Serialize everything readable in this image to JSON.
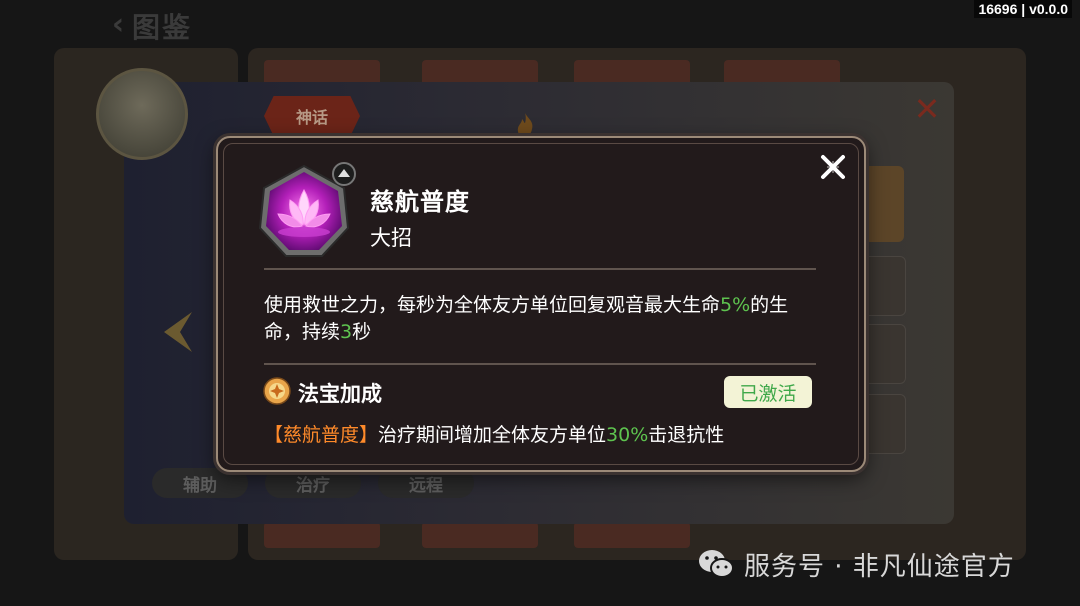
{
  "version_label": "16696 | v0.0.0",
  "header": {
    "title": "图鉴"
  },
  "character": {
    "rarity_badge": "神话",
    "tags": [
      "辅助",
      "治疗",
      "远程"
    ]
  },
  "skill_popup": {
    "name": "慈航普度",
    "type": "大招",
    "description": {
      "part1": "使用救世之力，每秒为全体友方单位回复观音最大生命",
      "percent": "5%",
      "part2": "的生命，持续",
      "duration": "3",
      "part3": "秒"
    },
    "bonus": {
      "title": "法宝加成",
      "status": "已激活",
      "skill_ref": "【慈航普度】",
      "text_before": "治疗期间增加全体友方单位",
      "percent": "30%",
      "text_after": "击退抗性"
    }
  },
  "watermark": {
    "text": "服务号 · 非凡仙途官方"
  },
  "colors": {
    "highlight_green": "#5ec34f",
    "bracket_orange": "#ff8a2a",
    "popup_bg": "#221a1b",
    "popup_border": "#9c8a78"
  },
  "icons": {
    "skill": "lotus-skill-icon",
    "bonus": "treasure-bonus-icon",
    "close": "close-icon",
    "back": "back-arrow-icon"
  }
}
